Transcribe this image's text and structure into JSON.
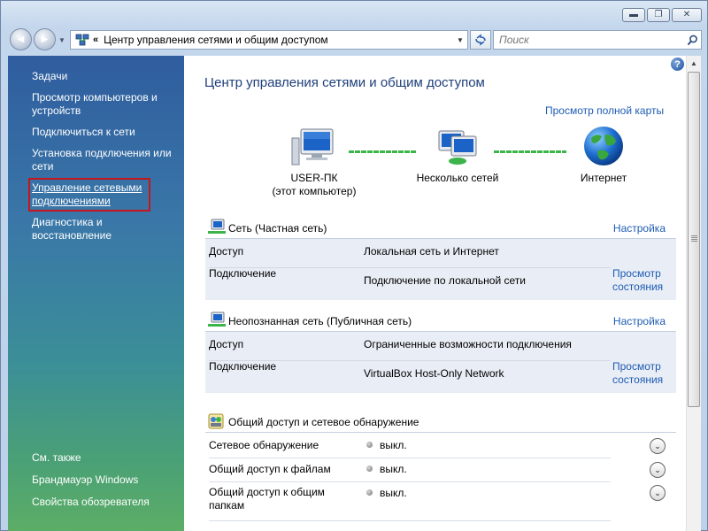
{
  "window": {
    "minimize_glyph": "▬",
    "maximize_glyph": "❐",
    "close_glyph": "✕"
  },
  "nav": {
    "back_glyph": "◀",
    "forward_glyph": "▶",
    "address_chevron": "«",
    "address_text": "Центр управления сетями и общим доступом",
    "search_placeholder": "Поиск"
  },
  "sidebar": {
    "heading": "Задачи",
    "items": [
      {
        "label": "Просмотр компьютеров и устройств"
      },
      {
        "label": "Подключиться к сети"
      },
      {
        "label": "Установка подключения или сети"
      },
      {
        "label": "Управление сетевыми подключениями",
        "selected": true
      },
      {
        "label": "Диагностика и восстановление"
      }
    ],
    "see_also": {
      "heading": "См. также",
      "items": [
        {
          "label": "Брандмауэр Windows"
        },
        {
          "label": "Свойства обозревателя"
        }
      ]
    }
  },
  "main": {
    "help_glyph": "?",
    "title": "Центр управления сетями и общим доступом",
    "full_map_link": "Просмотр полной карты",
    "map": {
      "computer": {
        "name": "USER-ПК",
        "sub": "(этот компьютер)"
      },
      "network": {
        "name": "Несколько сетей"
      },
      "internet": {
        "name": "Интернет"
      }
    },
    "networks": [
      {
        "title": "Сеть (Частная сеть)",
        "action": "Настройка",
        "access_label": "Доступ",
        "access_value": "Локальная сеть и Интернет",
        "connection_label": "Подключение",
        "connection_value": "Подключение по локальной сети",
        "view_status": "Просмотр состояния"
      },
      {
        "title": "Неопознанная сеть (Публичная сеть)",
        "action": "Настройка",
        "access_label": "Доступ",
        "access_value": "Ограниченные возможности подключения",
        "connection_label": "Подключение",
        "connection_value": "VirtualBox Host-Only Network",
        "view_status": "Просмотр состояния"
      }
    ],
    "sharing": {
      "title": "Общий доступ и сетевое обнаружение",
      "rows": [
        {
          "label": "Сетевое обнаружение",
          "state": "выкл."
        },
        {
          "label": "Общий доступ к файлам",
          "state": "выкл."
        },
        {
          "label": "Общий доступ к общим папкам",
          "state": "выкл."
        }
      ],
      "expand_glyph": "⌄"
    }
  },
  "colors": {
    "link": "#1e5cb3",
    "title": "#1e3f7a",
    "selection_outline": "#c5161c",
    "map_line": "#3bb54a"
  }
}
